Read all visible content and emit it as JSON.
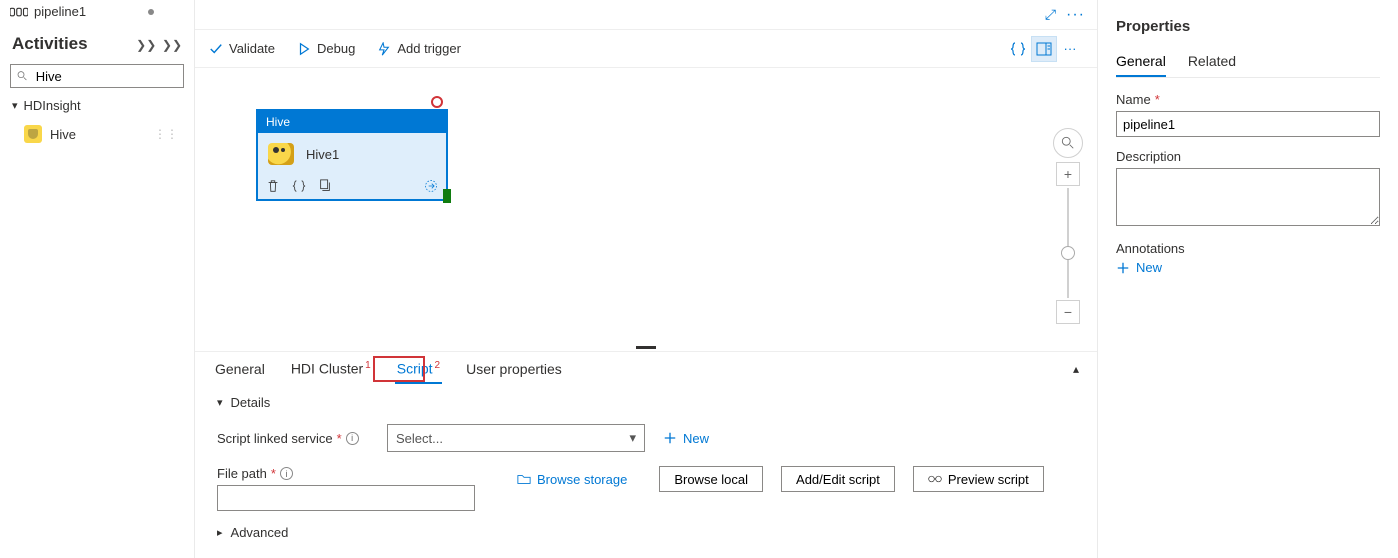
{
  "header": {
    "pipeline_tab": "pipeline1"
  },
  "activities": {
    "title": "Activities",
    "search_value": "Hive",
    "group_label": "HDInsight",
    "item_label": "Hive"
  },
  "toolbar": {
    "validate": "Validate",
    "debug": "Debug",
    "add_trigger": "Add trigger"
  },
  "node": {
    "type": "Hive",
    "name": "Hive1"
  },
  "bottom": {
    "tabs": {
      "general": "General",
      "hdi": "HDI Cluster",
      "script": "Script",
      "user_props": "User properties",
      "sup1": "1",
      "sup2": "2"
    },
    "details": "Details",
    "linked_label": "Script linked service",
    "linked_placeholder": "Select...",
    "new": "New",
    "filepath_label": "File path",
    "browse_storage": "Browse storage",
    "browse_local": "Browse local",
    "add_edit": "Add/Edit script",
    "preview": "Preview script",
    "advanced": "Advanced"
  },
  "properties": {
    "title": "Properties",
    "tabs": {
      "general": "General",
      "related": "Related"
    },
    "name_label": "Name",
    "name_value": "pipeline1",
    "desc_label": "Description",
    "desc_value": "",
    "ann_label": "Annotations",
    "ann_new": "New"
  }
}
